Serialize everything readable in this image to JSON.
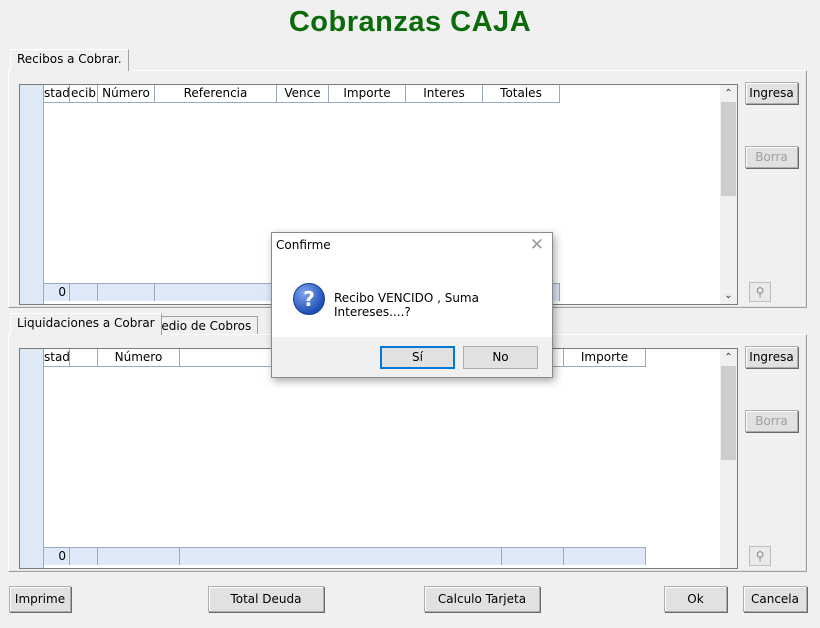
{
  "window": {
    "title": "Cobranzas CAJA"
  },
  "recibos": {
    "tab_label": "Recibos a Cobrar.",
    "columns": [
      "stad",
      "ecib",
      "Número",
      "Referencia",
      "Vence",
      "Importe",
      "Interes",
      "Totales"
    ],
    "footer_first": "0",
    "ingresa_label": "Ingresa",
    "borra_label": "Borra"
  },
  "liquidaciones": {
    "tabs": [
      "Liquidaciones a Cobrar",
      "Medio de Cobros"
    ],
    "columns": [
      "stad",
      "",
      "Número",
      "",
      "",
      "Importe"
    ],
    "footer_first": "0",
    "ingresa_label": "Ingresa",
    "borra_label": "Borra"
  },
  "bottom_buttons": {
    "imprime": "Imprime",
    "total_deuda": "Total Deuda",
    "calculo_tarjeta": "Calculo Tarjeta",
    "ok": "Ok",
    "cancela": "Cancela"
  },
  "dialog": {
    "title": "Confirme",
    "message": "Recibo VENCIDO , Suma Intereses....?",
    "yes_label": "Sí",
    "no_label": "No",
    "icon": "question-icon"
  },
  "colors": {
    "title_green": "#0b6b0b",
    "grid_header_blue": "#dde9f7"
  }
}
